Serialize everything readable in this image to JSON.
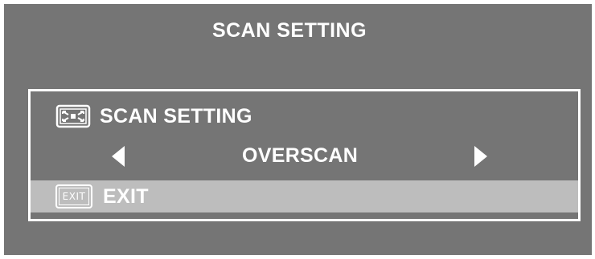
{
  "osd": {
    "title": "SCAN SETTING",
    "menu": {
      "setting_label": "SCAN SETTING",
      "setting_icon": "scan-setting-icon",
      "value": "OVERSCAN",
      "exit_icon_text": "EXIT",
      "exit_label": "EXIT"
    }
  }
}
